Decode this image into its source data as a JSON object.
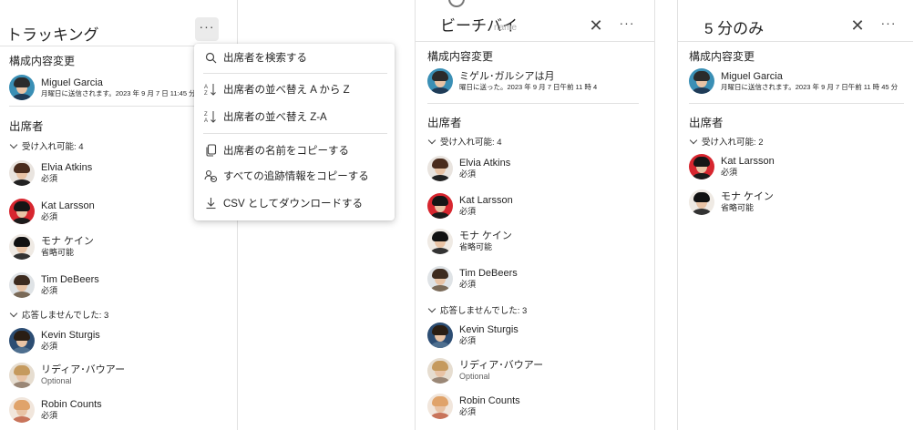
{
  "panel1": {
    "title": "トラッキング",
    "more_icon": "more-horizontal-icon",
    "changes_label": "構成内容変更",
    "organizer": {
      "name": "Miguel Garcia",
      "sent": "月曜日に送信されます。2023 年 9 月 7 日 11:45 分"
    },
    "attendees_label": "出席者",
    "accepted_label": "受け入れ可能: 4",
    "accepted": [
      {
        "name": "Elvia Atkins",
        "status": "必須"
      },
      {
        "name": "Kat Larsson",
        "status": "必須"
      },
      {
        "name": "モナ ケイン",
        "status": "省略可能"
      },
      {
        "name": "Tim DeBeers",
        "status": "必須"
      }
    ],
    "noreply_label": "応答しませんでした: 3",
    "noreply": [
      {
        "name": "Kevin Sturgis",
        "status": "必須"
      },
      {
        "name": "リディア･バウアー",
        "status": "Optional"
      },
      {
        "name": "Robin Counts",
        "status": "必須"
      }
    ]
  },
  "menu": {
    "items": [
      {
        "label": "出席者を検索する",
        "icon": "search-icon"
      },
      {
        "label": "出席者の並べ替え A から Z",
        "icon": "sort-ascending-icon"
      },
      {
        "label": "出席者の並べ替え Z-A",
        "icon": "sort-descending-icon"
      },
      {
        "label": "出席者の名前をコピーする",
        "icon": "copy-icon"
      },
      {
        "label": "すべての追跡情報をコピーする",
        "icon": "copy-people-icon"
      },
      {
        "label": "CSV としてダウンロードする",
        "icon": "download-icon"
      }
    ]
  },
  "panel2": {
    "title": "ビーチバイ",
    "overlay_text": "name",
    "close_icon": "close-icon",
    "more_icon": "more-horizontal-icon",
    "changes_label": "構成内容変更",
    "organizer": {
      "name": "ミゲル･ガルシアは月",
      "sent": "曜日に送った。2023 年 9 月 7 日午前 11 時 4"
    },
    "attendees_label": "出席者",
    "accepted_label": "受け入れ可能: 4",
    "accepted": [
      {
        "name": "Elvia Atkins",
        "status": "必須"
      },
      {
        "name": "Kat Larsson",
        "status": "必須"
      },
      {
        "name": "モナ ケイン",
        "status": "省略可能"
      },
      {
        "name": "Tim DeBeers",
        "status": "必須"
      }
    ],
    "noreply_label": "応答しませんでした: 3",
    "noreply": [
      {
        "name": "Kevin Sturgis",
        "status": "必須"
      },
      {
        "name": "リディア･バウアー",
        "status": "Optional"
      },
      {
        "name": "Robin Counts",
        "status": "必須"
      }
    ]
  },
  "panel3": {
    "title": "5 分のみ",
    "close_icon": "close-icon",
    "more_icon": "more-horizontal-icon",
    "changes_label": "構成内容変更",
    "organizer": {
      "name": "Miguel Garcia",
      "sent": "月曜日に送信されます。2023 年 9 月 7 日午前 11 時 45 分"
    },
    "attendees_label": "出席者",
    "accepted_label": "受け入れ可能: 2",
    "accepted": [
      {
        "name": "Kat Larsson",
        "status": "必須"
      },
      {
        "name": "モナ ケイン",
        "status": "省略可能"
      }
    ]
  },
  "colors": {
    "divider": "#e1e1e1",
    "active_button": "#ebebeb",
    "muted_text": "#616161"
  }
}
